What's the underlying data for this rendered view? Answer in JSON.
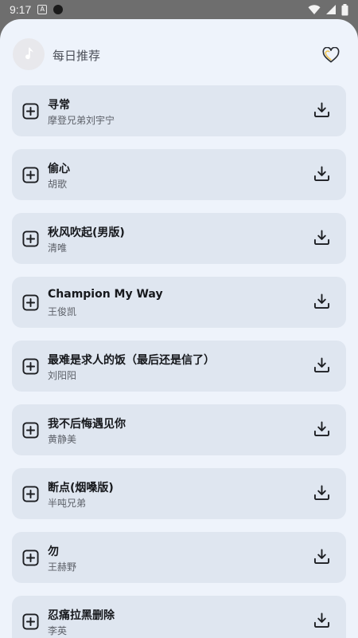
{
  "status_bar": {
    "time": "9:17",
    "a_icon_letter": "A"
  },
  "header": {
    "title": "每日推荐"
  },
  "songs": [
    {
      "title": "寻常",
      "artist": "摩登兄弟刘宇宁"
    },
    {
      "title": "偷心",
      "artist": "胡歌"
    },
    {
      "title": "秋风吹起(男版)",
      "artist": "清唯"
    },
    {
      "title": "Champion My Way",
      "artist": "王俊凯"
    },
    {
      "title": "最难是求人的饭（最后还是信了）",
      "artist": "刘阳阳"
    },
    {
      "title": "我不后悔遇见你",
      "artist": "黄静美"
    },
    {
      "title": "断点(烟嗓版)",
      "artist": "半吨兄弟"
    },
    {
      "title": "勿",
      "artist": "王赫野"
    },
    {
      "title": "忍痛拉黑删除",
      "artist": "李英"
    }
  ],
  "icons": {
    "avatar": "music-note-icon",
    "favorite": "heart-icon",
    "add": "add-square-icon",
    "download": "download-icon"
  },
  "colors": {
    "sheet_background": "#eef3fb",
    "card_background": "#dfe6f0",
    "status_bar": "#6e6e6e",
    "heart_accent": "#f0c24a"
  }
}
